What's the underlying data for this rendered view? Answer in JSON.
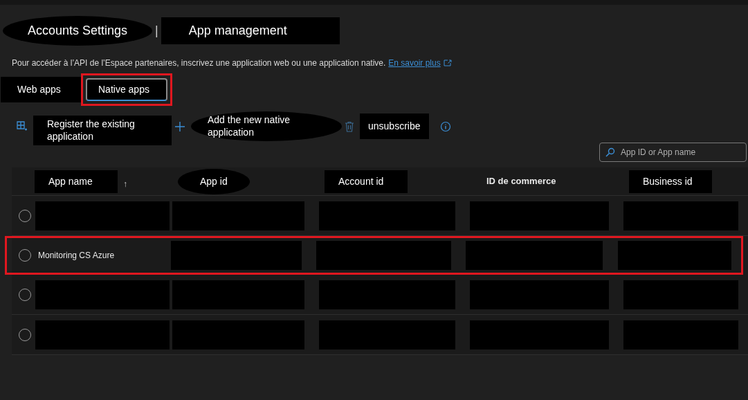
{
  "breadcrumb": [
    {
      "label": "Accounts Settings"
    },
    {
      "label": "App management"
    }
  ],
  "breadcrumb_separator": "|",
  "description": {
    "text": "Pour accéder à l’API de l’Espace partenaires, inscrivez une application web ou une application native.",
    "link": "En savoir plus"
  },
  "tabs": [
    {
      "label": "Web apps",
      "selected": false,
      "highlighted": false
    },
    {
      "label": "Native apps",
      "selected": true,
      "highlighted": true
    }
  ],
  "toolbar": [
    {
      "kind": "register",
      "label": "Register the existing application"
    },
    {
      "kind": "add",
      "label": "Add the new native application"
    },
    {
      "kind": "delete",
      "label": "unsubscribe"
    },
    {
      "kind": "info"
    }
  ],
  "search": {
    "placeholder": "App ID or App name"
  },
  "table": {
    "columns": [
      {
        "label": "App name",
        "masked": true,
        "sort_indicator": "↑"
      },
      {
        "label": "App id",
        "masked": true
      },
      {
        "label": "Account id",
        "masked": true
      },
      {
        "label": "ID de commerce",
        "masked": false
      },
      {
        "label": "Business id",
        "masked": true
      }
    ],
    "rows": [
      {
        "selected": false,
        "highlighted": false,
        "cells": [
          {
            "redacted": true
          },
          {
            "redacted": true
          },
          {
            "redacted": true
          },
          {
            "redacted": true
          },
          {
            "redacted": true
          }
        ]
      },
      {
        "selected": false,
        "highlighted": true,
        "cells": [
          {
            "redacted": false,
            "text": "Monitoring CS Azure"
          },
          {
            "redacted": true
          },
          {
            "redacted": true
          },
          {
            "redacted": true
          },
          {
            "redacted": true
          }
        ]
      },
      {
        "selected": false,
        "highlighted": false,
        "cells": [
          {
            "redacted": true
          },
          {
            "redacted": true
          },
          {
            "redacted": true
          },
          {
            "redacted": true
          },
          {
            "redacted": true
          }
        ]
      },
      {
        "selected": false,
        "highlighted": false,
        "cells": [
          {
            "redacted": true
          },
          {
            "redacted": true
          },
          {
            "redacted": true
          },
          {
            "redacted": true
          },
          {
            "redacted": true
          }
        ]
      }
    ]
  }
}
